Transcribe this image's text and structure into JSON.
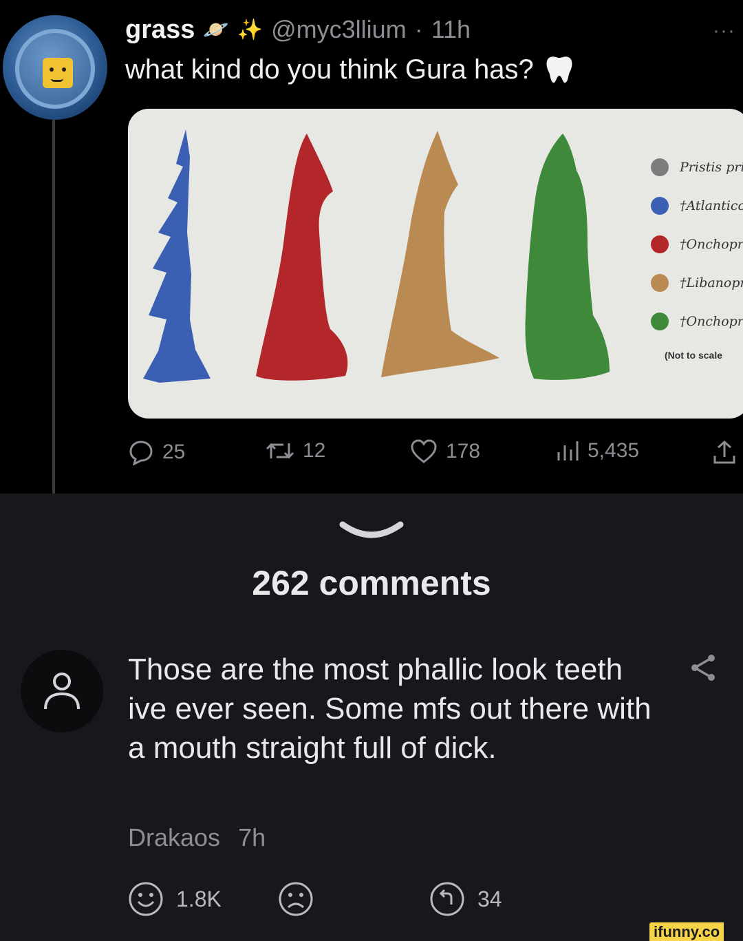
{
  "tweet": {
    "display_name": "grass",
    "name_emojis": [
      "planet-emoji",
      "sparkles-emoji"
    ],
    "handle": "@myc3llium",
    "separator": "·",
    "time": "11h",
    "more": "···",
    "text": "what kind do you think Gura has?",
    "text_emoji": "tooth-emoji",
    "image": {
      "background": "#e7e8e3",
      "legend": [
        {
          "label": "Pristis pri",
          "color": "#7c7c7c"
        },
        {
          "label": "†Atlantico",
          "color": "#3a5fb3"
        },
        {
          "label": "†Onchopr",
          "color": "#b3262a"
        },
        {
          "label": "†Libanopr",
          "color": "#b98a52"
        },
        {
          "label": "†Onchopr",
          "color": "#3e8a3a"
        }
      ],
      "note": "(Not to scale",
      "tooth_colors": [
        "#3a5fb3",
        "#b3262a",
        "#b98a52",
        "#3e8a3a"
      ]
    },
    "actions": {
      "replies": "25",
      "retweets": "12",
      "likes": "178",
      "views": "5,435"
    }
  },
  "comments": {
    "count_label": "262 comments",
    "items": [
      {
        "text": "Those are the most phallic look teeth ive ever seen. Some mfs out there with a mouth straight full of dick.",
        "author": "Drakaos",
        "time": "7h",
        "upvotes": "1.8K",
        "replies": "34"
      }
    ]
  },
  "watermark": "ifunny.co"
}
